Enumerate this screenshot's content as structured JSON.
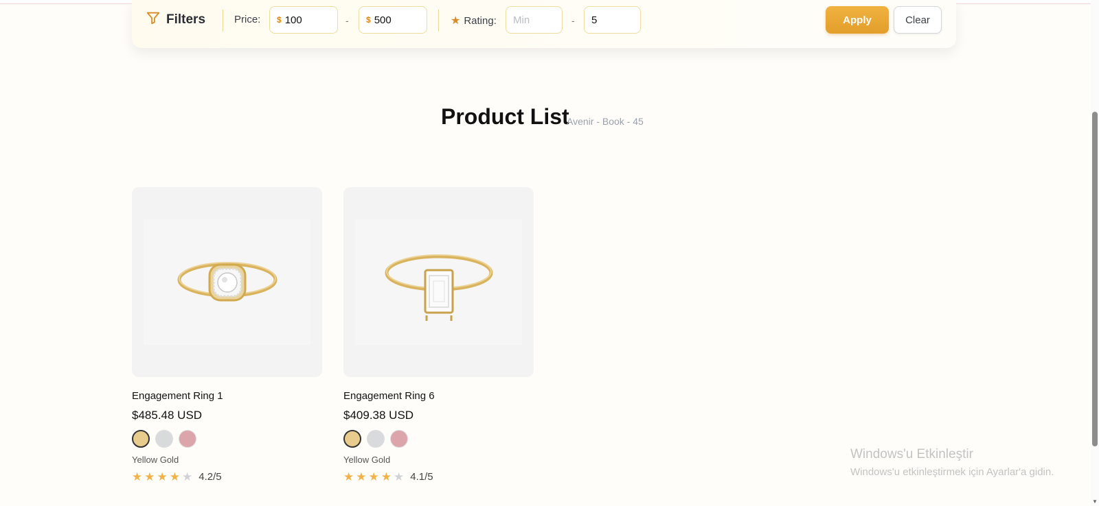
{
  "filters": {
    "title": "Filters",
    "price_label": "Price:",
    "currency_symbol": "$",
    "price_min": "100",
    "price_max": "500",
    "dash": "-",
    "rating_label": "Rating:",
    "rating_min_placeholder": "Min",
    "rating_max": "5",
    "apply_label": "Apply",
    "clear_label": "Clear"
  },
  "header": {
    "title": "Product List",
    "subtitle": "Avenir - Book - 45"
  },
  "products": [
    {
      "name": "Engagement Ring 1",
      "price": "$485.48 USD",
      "metal": "Yellow Gold",
      "rating": "4.2/5",
      "rating_value": 4.2,
      "swatch_colors": [
        "#e8cc8e",
        "#d9dadc",
        "#dba5ab"
      ]
    },
    {
      "name": "Engagement Ring 6",
      "price": "$409.38 USD",
      "metal": "Yellow Gold",
      "rating": "4.1/5",
      "rating_value": 4.1,
      "swatch_colors": [
        "#e8cc8e",
        "#d9dadc",
        "#dba5ab"
      ]
    }
  ],
  "watermark": {
    "line1": "Windows'u Etkinleştir",
    "line2": "Windows'u etkinleştirmek için Ayarlar'a gidin."
  },
  "colors": {
    "accent": "#e8a633",
    "star_on": "#f1b24a",
    "star_off": "#cfd3d8"
  }
}
